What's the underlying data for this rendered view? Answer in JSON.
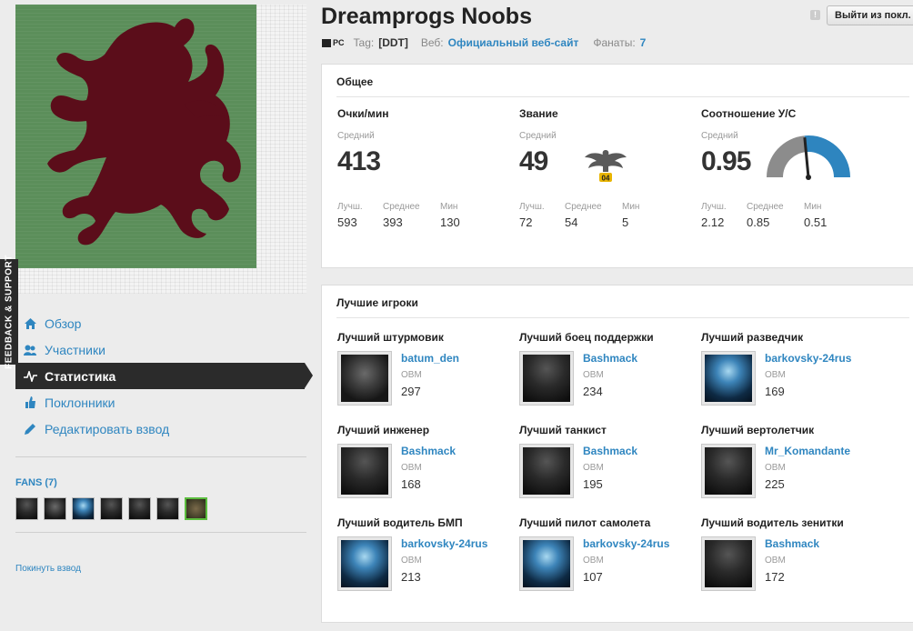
{
  "header": {
    "title": "Dreamprogs Noobs",
    "platform": "PC",
    "tag_label": "Tag:",
    "tag_value": "[DDT]",
    "web_label": "Веб:",
    "web_value": "Официальный веб-сайт",
    "fans_label": "Фанаты:",
    "fans_value": "7",
    "leave_button": "Выйти из покл.",
    "report_icon": "warning-icon"
  },
  "feedback_tab": "FEEDBACK & SUPPORT",
  "sidebar": {
    "items": [
      {
        "label": "Обзор",
        "icon": "home-icon",
        "active": false
      },
      {
        "label": "Участники",
        "icon": "users-icon",
        "active": false
      },
      {
        "label": "Статистика",
        "icon": "pulse-icon",
        "active": true
      },
      {
        "label": "Поклонники",
        "icon": "thumb-icon",
        "active": false
      },
      {
        "label": "Редактировать взвод",
        "icon": "pencil-icon",
        "active": false
      }
    ],
    "fans_title": "FANS (7)",
    "fans_count": 7,
    "leave_link": "Покинуть взвод"
  },
  "general": {
    "title": "Общее",
    "stats": [
      {
        "head": "Очки/мин",
        "sub": "Средний",
        "big": "413",
        "mini": [
          {
            "lbl": "Лучш.",
            "val": "593"
          },
          {
            "lbl": "Среднее",
            "val": "393"
          },
          {
            "lbl": "Мин",
            "val": "130"
          }
        ]
      },
      {
        "head": "Звание",
        "sub": "Средний",
        "big": "49",
        "rank_badge": "04",
        "mini": [
          {
            "lbl": "Лучш.",
            "val": "72"
          },
          {
            "lbl": "Среднее",
            "val": "54"
          },
          {
            "lbl": "Мин",
            "val": "5"
          }
        ]
      },
      {
        "head": "Соотношение У/С",
        "sub": "Средний",
        "big": "0.95",
        "gauge_fraction": 0.47,
        "mini": [
          {
            "lbl": "Лучш.",
            "val": "2.12"
          },
          {
            "lbl": "Среднее",
            "val": "0.85"
          },
          {
            "lbl": "Мин",
            "val": "0.51"
          }
        ]
      }
    ],
    "colors": {
      "gauge_fill": "#2e85bf",
      "gauge_empty": "#8c8c8c"
    }
  },
  "best_players": {
    "title": "Лучшие игроки",
    "obm_label": "ОВМ",
    "cells": [
      {
        "role": "Лучший штурмовик",
        "name": "batum_den",
        "score": "297",
        "avatar": "dark"
      },
      {
        "role": "Лучший боец поддержки",
        "name": "Bashmack",
        "score": "234",
        "avatar": "soldier"
      },
      {
        "role": "Лучший разведчик",
        "name": "barkovsky-24rus",
        "score": "169",
        "avatar": "blue"
      },
      {
        "role": "Лучший инженер",
        "name": "Bashmack",
        "score": "168",
        "avatar": "soldier"
      },
      {
        "role": "Лучший танкист",
        "name": "Bashmack",
        "score": "195",
        "avatar": "soldier"
      },
      {
        "role": "Лучший вертолетчик",
        "name": "Mr_Komandante",
        "score": "225",
        "avatar": "soldier"
      },
      {
        "role": "Лучший водитель БМП",
        "name": "barkovsky-24rus",
        "score": "213",
        "avatar": "blue"
      },
      {
        "role": "Лучший пилот самолета",
        "name": "barkovsky-24rus",
        "score": "107",
        "avatar": "blue"
      },
      {
        "role": "Лучший водитель зенитки",
        "name": "Bashmack",
        "score": "172",
        "avatar": "soldier"
      }
    ]
  }
}
